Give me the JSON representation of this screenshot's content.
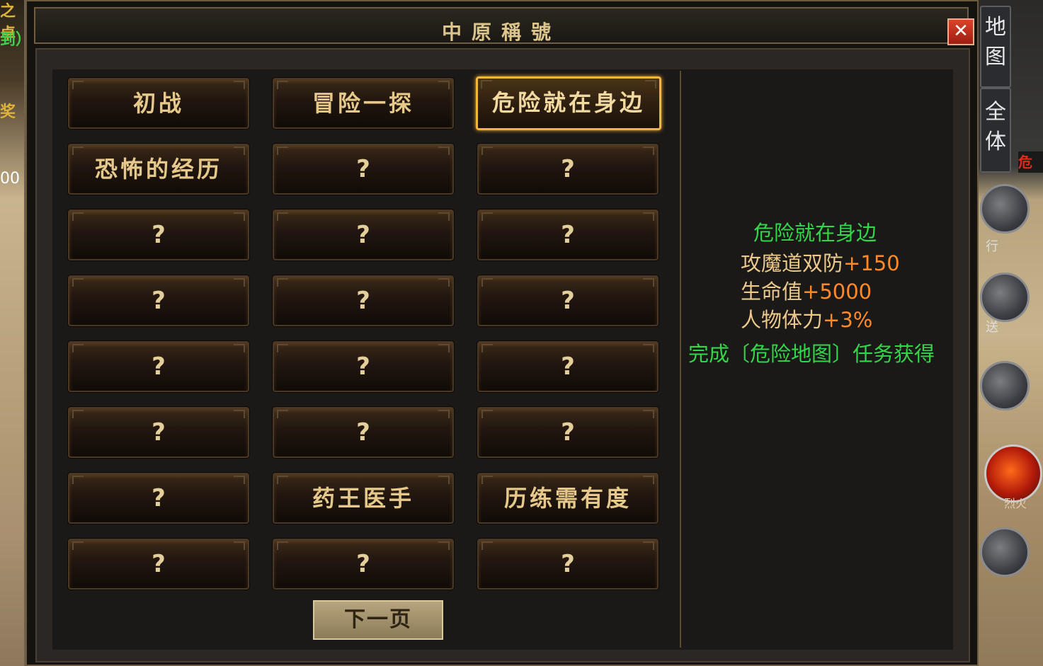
{
  "background": {
    "left_texts": [
      "之卓",
      "到）",
      "奖",
      "00"
    ],
    "map_buttons": [
      "地图",
      "全体"
    ],
    "skill_labels": [
      "行",
      "送",
      "烈火"
    ],
    "danger_tag": "危"
  },
  "dialog": {
    "title": "中原稱號",
    "close_label": "✕",
    "next_page_label": "下一页",
    "titles": [
      {
        "label": "初战",
        "unlocked": true,
        "selected": false
      },
      {
        "label": "冒险一探",
        "unlocked": true,
        "selected": false
      },
      {
        "label": "危险就在身边",
        "unlocked": true,
        "selected": true
      },
      {
        "label": "恐怖的经历",
        "unlocked": true,
        "selected": false
      },
      {
        "label": "?",
        "unlocked": false,
        "selected": false
      },
      {
        "label": "?",
        "unlocked": false,
        "selected": false
      },
      {
        "label": "?",
        "unlocked": false,
        "selected": false
      },
      {
        "label": "?",
        "unlocked": false,
        "selected": false
      },
      {
        "label": "?",
        "unlocked": false,
        "selected": false
      },
      {
        "label": "?",
        "unlocked": false,
        "selected": false
      },
      {
        "label": "?",
        "unlocked": false,
        "selected": false
      },
      {
        "label": "?",
        "unlocked": false,
        "selected": false
      },
      {
        "label": "?",
        "unlocked": false,
        "selected": false
      },
      {
        "label": "?",
        "unlocked": false,
        "selected": false
      },
      {
        "label": "?",
        "unlocked": false,
        "selected": false
      },
      {
        "label": "?",
        "unlocked": false,
        "selected": false
      },
      {
        "label": "?",
        "unlocked": false,
        "selected": false
      },
      {
        "label": "?",
        "unlocked": false,
        "selected": false
      },
      {
        "label": "?",
        "unlocked": false,
        "selected": false
      },
      {
        "label": "药王医手",
        "unlocked": true,
        "selected": false
      },
      {
        "label": "历练需有度",
        "unlocked": true,
        "selected": false
      },
      {
        "label": "?",
        "unlocked": false,
        "selected": false
      },
      {
        "label": "?",
        "unlocked": false,
        "selected": false
      },
      {
        "label": "?",
        "unlocked": false,
        "selected": false
      }
    ],
    "detail": {
      "name": "危险就在身边",
      "attributes": [
        {
          "label": "攻魔道双防",
          "value": "+150"
        },
        {
          "label": "生命值",
          "value": "+5000"
        },
        {
          "label": "人物体力",
          "value": "+3%"
        }
      ],
      "requirement": "完成〔危险地图〕任务获得"
    }
  },
  "colors": {
    "gold_text": "#e6c98a",
    "selected_border": "#f3b63a",
    "green_text": "#33d64a",
    "orange_value": "#ff8a2a",
    "close_red": "#c9341e"
  }
}
